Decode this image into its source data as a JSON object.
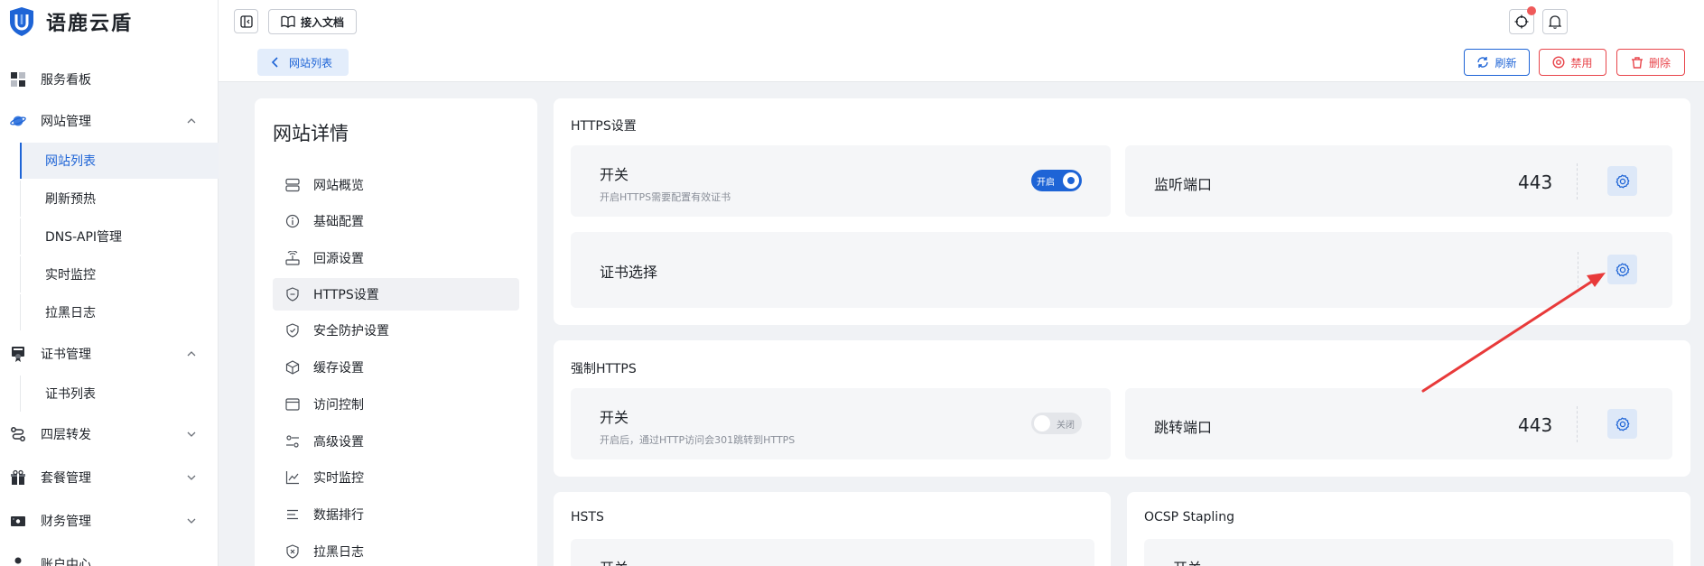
{
  "brand": {
    "name": "语鹿云盾"
  },
  "sidebar": {
    "items": [
      {
        "label": "服务看板",
        "icon": "dashboard-icon"
      },
      {
        "label": "网站管理",
        "icon": "planet-icon"
      },
      {
        "label": "证书管理",
        "icon": "certificate-icon"
      },
      {
        "label": "四层转发",
        "icon": "route-icon"
      },
      {
        "label": "套餐管理",
        "icon": "gift-icon"
      },
      {
        "label": "财务管理",
        "icon": "wallet-icon"
      },
      {
        "label": "账户中心",
        "icon": "user-icon"
      }
    ],
    "website_sub": [
      "网站列表",
      "刷新预热",
      "DNS-API管理",
      "实时监控",
      "拉黑日志"
    ],
    "cert_sub": [
      "证书列表"
    ]
  },
  "header": {
    "docs_label": "接入文档",
    "back_label": "网站列表",
    "refresh_label": "刷新",
    "disable_label": "禁用",
    "delete_label": "删除"
  },
  "detail": {
    "title": "网站详情",
    "menu": [
      {
        "label": "网站概览",
        "icon": "server-icon"
      },
      {
        "label": "基础配置",
        "icon": "info-icon"
      },
      {
        "label": "回源设置",
        "icon": "router-icon"
      },
      {
        "label": "HTTPS设置",
        "icon": "shield-icon"
      },
      {
        "label": "安全防护设置",
        "icon": "shield-check-icon"
      },
      {
        "label": "缓存设置",
        "icon": "cube-icon"
      },
      {
        "label": "访问控制",
        "icon": "window-icon"
      },
      {
        "label": "高级设置",
        "icon": "sliders-icon"
      },
      {
        "label": "实时监控",
        "icon": "chart-icon"
      },
      {
        "label": "数据排行",
        "icon": "list-icon"
      },
      {
        "label": "拉黑日志",
        "icon": "shield-x-icon"
      }
    ]
  },
  "https": {
    "title": "HTTPS设置",
    "switch_label": "开关",
    "switch_desc": "开启HTTPS需要配置有效证书",
    "switch_state": "开启",
    "port_label": "监听端口",
    "port_value": "443",
    "cert_label": "证书选择"
  },
  "force_https": {
    "title": "强制HTTPS",
    "switch_label": "开关",
    "switch_desc": "开启后，通过HTTP访问会301跳转到HTTPS",
    "switch_state": "关闭",
    "port_label": "跳转端口",
    "port_value": "443"
  },
  "hsts": {
    "title": "HSTS",
    "switch_label": "开关"
  },
  "ocsp": {
    "title": "OCSP Stapling",
    "switch_label": "开关"
  },
  "colors": {
    "primary": "#1e64d6",
    "danger": "#e8454b",
    "arrow": "#e83a3a"
  }
}
